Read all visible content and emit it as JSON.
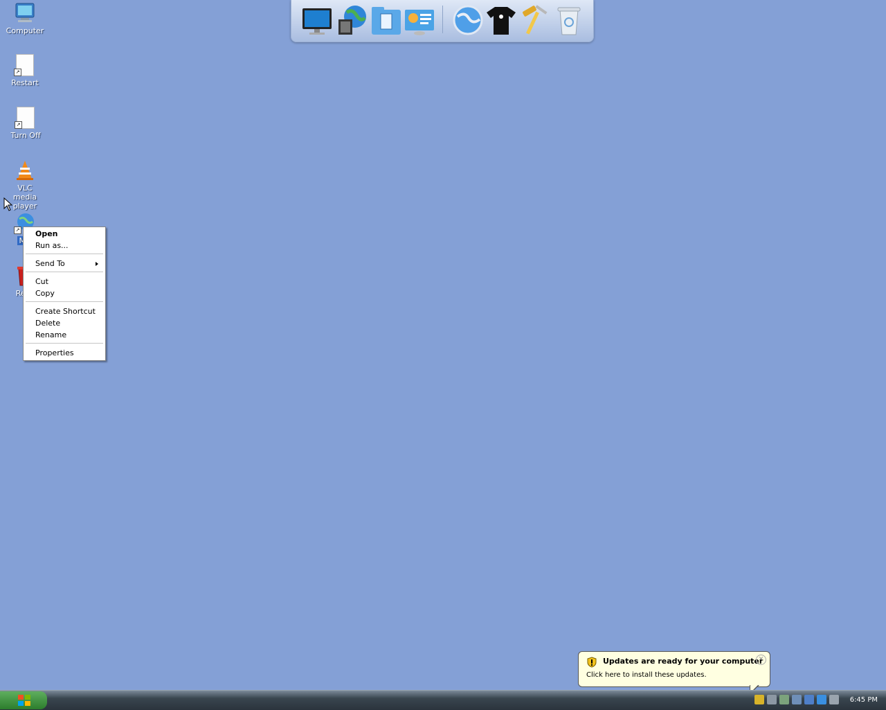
{
  "desktop": {
    "icons": [
      {
        "label": "Computer",
        "icon": "computer-icon"
      },
      {
        "label": "Restart",
        "icon": "document-shortcut-icon"
      },
      {
        "label": "Turn Off",
        "icon": "document-shortcut-icon"
      },
      {
        "label": "VLC media player",
        "icon": "vlc-cone-icon"
      },
      {
        "label": "MV",
        "icon": "globe-shortcut-icon"
      },
      {
        "label": "Recy",
        "icon": "recycle-bin-icon"
      }
    ]
  },
  "dock": {
    "items": [
      {
        "icon": "monitor-icon"
      },
      {
        "icon": "globe-film-icon"
      },
      {
        "icon": "document-folder-icon"
      },
      {
        "icon": "settings-panel-icon"
      },
      {
        "icon": "internet-globe-icon"
      },
      {
        "icon": "tshirt-icon"
      },
      {
        "icon": "hammer-tools-icon"
      },
      {
        "icon": "recycle-bin-icon"
      }
    ]
  },
  "context_menu": {
    "items": [
      "Open",
      "Run as...",
      "Send To",
      "Cut",
      "Copy",
      "Create Shortcut",
      "Delete",
      "Rename",
      "Properties"
    ]
  },
  "notification": {
    "title": "Updates are ready for your computer",
    "text": "Click here to install these updates.",
    "icon": "shield-warning-icon"
  },
  "taskbar": {
    "clock": "6:45 PM",
    "tray_icons": [
      "shield-icon",
      "network-icon",
      "sync-icon",
      "device-icon",
      "display-icon",
      "app-icon",
      "window-icon"
    ]
  },
  "colors": {
    "desktop": "#84a0d6",
    "balloon": "#ffffe1"
  }
}
